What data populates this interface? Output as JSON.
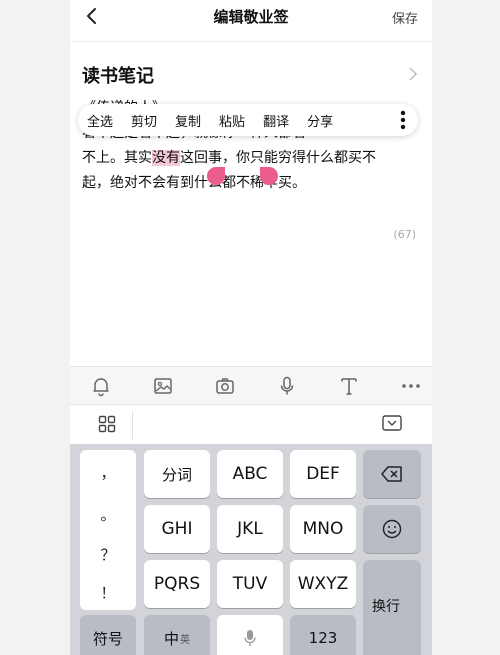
{
  "header": {
    "title": "编辑敬业签",
    "save_label": "保存"
  },
  "note": {
    "title": "读书笔记",
    "lines": [
      "《传递的人》",
      "看不起是看不起，就像你一样人都看",
      "不上。其实没有这回事，你只能穷得什么都买不",
      "起，绝对不会有到什么都不稀罕买。"
    ],
    "line3_before": "不上。其实",
    "line3_selected": "没有",
    "line3_after": "这回事，你只能穷得什么都买不",
    "char_count": "(67)"
  },
  "context_menu": {
    "items": [
      "全选",
      "剪切",
      "复制",
      "粘贴",
      "翻译",
      "分享"
    ]
  },
  "toolbar": {
    "icons": [
      "bell-icon",
      "image-icon",
      "camera-icon",
      "microphone-icon",
      "text-format-icon",
      "more-icon"
    ]
  },
  "keyboard": {
    "punctuation": [
      "，",
      "。",
      "？",
      "！"
    ],
    "row1": [
      "分词",
      "ABC",
      "DEF"
    ],
    "row2": [
      "GHI",
      "JKL",
      "MNO"
    ],
    "row3": [
      "PQRS",
      "TUV",
      "WXYZ"
    ],
    "symbol_label": "符号",
    "lang_label": "中",
    "lang_sub": "英",
    "num_label": "123",
    "enter_label": "换行"
  }
}
